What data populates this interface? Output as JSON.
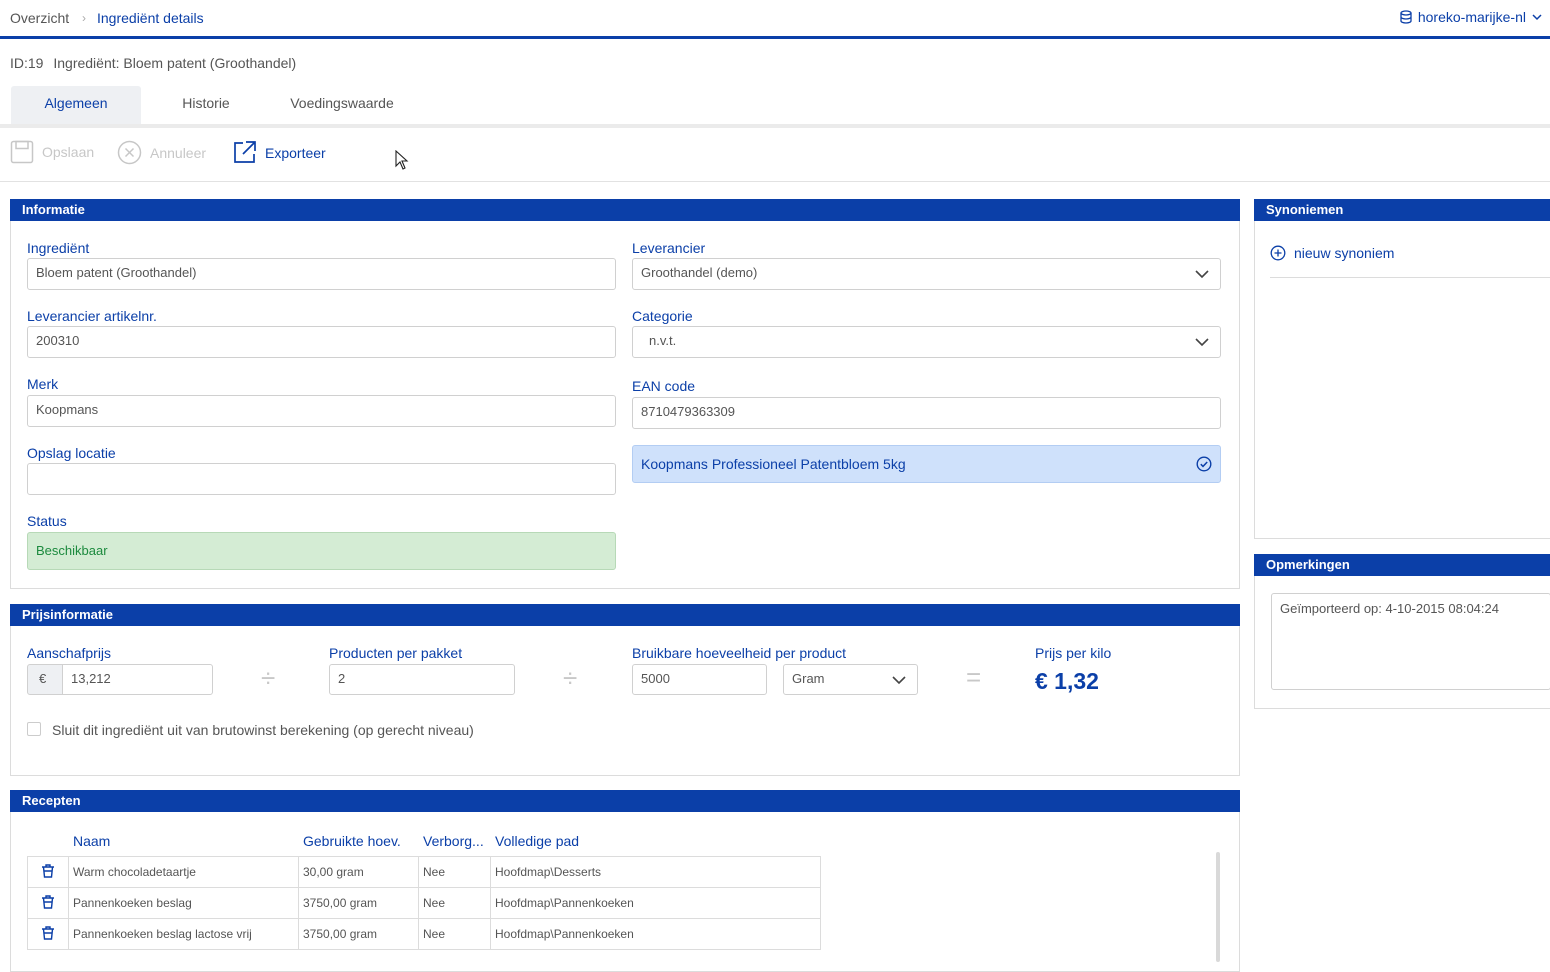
{
  "breadcrumb": {
    "root": "Overzicht",
    "current": "Ingrediënt details"
  },
  "tenant": {
    "name": "horeko-marijke-nl",
    "icon": "database-icon"
  },
  "header": {
    "id_label": "ID:19",
    "title": "Ingrediënt: Bloem patent (Groothandel)"
  },
  "tabs": [
    {
      "label": "Algemeen",
      "active": true
    },
    {
      "label": "Historie"
    },
    {
      "label": "Voedingswaarde"
    }
  ],
  "toolbar": {
    "save": "Opslaan",
    "cancel": "Annuleer",
    "export": "Exporteer"
  },
  "info": {
    "title": "Informatie",
    "ingredient": {
      "label": "Ingrediënt",
      "value": "Bloem patent (Groothandel)"
    },
    "supplier_artnr": {
      "label": "Leverancier artikelnr.",
      "value": "200310"
    },
    "brand": {
      "label": "Merk",
      "value": "Koopmans"
    },
    "storage": {
      "label": "Opslag locatie",
      "value": ""
    },
    "status": {
      "label": "Status",
      "value": "Beschikbaar"
    },
    "supplier": {
      "label": "Leverancier",
      "value": "Groothandel (demo)"
    },
    "category": {
      "label": "Categorie",
      "value": "n.v.t."
    },
    "ean": {
      "label": "EAN code",
      "value": "8710479363309"
    },
    "ean_match": "Koopmans Professioneel Patentbloem 5kg"
  },
  "price": {
    "title": "Prijsinformatie",
    "purchase": {
      "label": "Aanschafprijs",
      "currency": "€",
      "value": "13,212"
    },
    "per_pack": {
      "label": "Producten per pakket",
      "value": "2"
    },
    "usable": {
      "label": "Bruikbare hoeveelheid per product",
      "value": "5000",
      "unit": "Gram"
    },
    "per_kilo": {
      "label": "Prijs per kilo",
      "value": "€ 1,32"
    },
    "exclude_label": "Sluit dit ingrediënt uit van brutowinst berekening (op gerecht niveau)"
  },
  "recipes": {
    "title": "Recepten",
    "columns": [
      "Naam",
      "Gebruikte hoev.",
      "Verborg...",
      "Volledige pad"
    ],
    "rows": [
      {
        "name": "Warm chocoladetaartje",
        "amount": "30,00 gram",
        "hidden": "Nee",
        "path": "Hoofdmap\\Desserts"
      },
      {
        "name": "Pannenkoeken beslag",
        "amount": "3750,00 gram",
        "hidden": "Nee",
        "path": "Hoofdmap\\Pannenkoeken"
      },
      {
        "name": "Pannenkoeken beslag lactose vrij",
        "amount": "3750,00 gram",
        "hidden": "Nee",
        "path": "Hoofdmap\\Pannenkoeken"
      }
    ]
  },
  "synonyms": {
    "title": "Synoniemen",
    "add_label": "nieuw synoniem"
  },
  "remarks": {
    "title": "Opmerkingen",
    "text": "Geïmporteerd op: 4-10-2015 08:04:24"
  },
  "colors": {
    "primary": "#0b3fa8",
    "status_bg": "#d4ecd4",
    "match_bg": "#cfe1fb"
  }
}
